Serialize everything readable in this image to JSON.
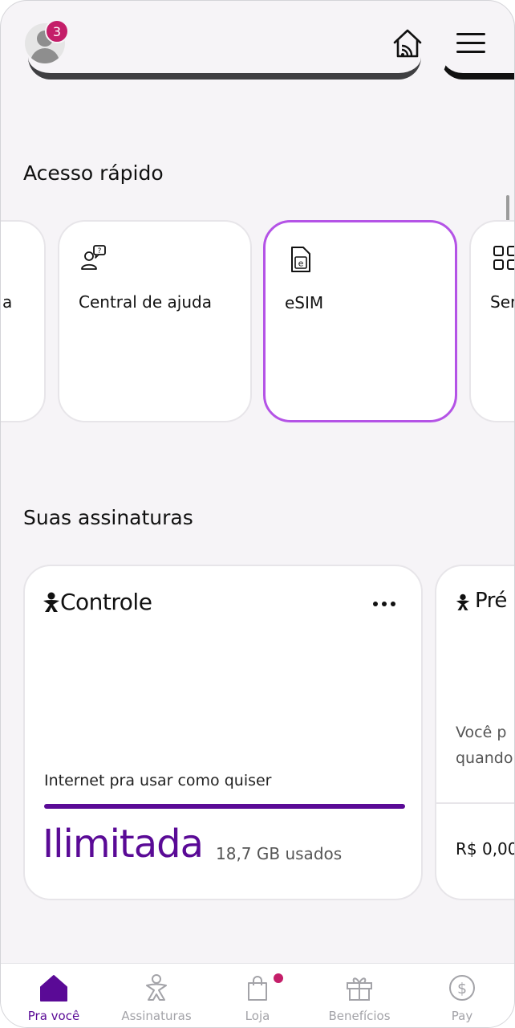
{
  "header": {
    "notification_count": "3",
    "avatar_icon": "user-avatar-icon",
    "home_icon": "smart-home-icon",
    "menu_icon": "hamburger-menu-icon"
  },
  "quick_access": {
    "title": "Acesso rápido",
    "items": [
      {
        "label": "a",
        "icon": ""
      },
      {
        "label": "Central de ajuda",
        "icon": "help-chat-icon"
      },
      {
        "label": "eSIM",
        "icon": "esim-icon"
      },
      {
        "label": "Ser",
        "icon": "grid-icon"
      }
    ]
  },
  "subscriptions": {
    "title": "Suas assinaturas",
    "cards": [
      {
        "brand": "Controle",
        "menu_icon": "more-dots-icon",
        "description": "Internet pra usar como quiser",
        "value": "Ilimitada",
        "usage": "18,7 GB usados",
        "progress": 1.0
      },
      {
        "brand": "Pré",
        "line1": "Você p",
        "line2": "quando",
        "price": "R$ 0,00"
      }
    ]
  },
  "bottom_nav": {
    "items": [
      {
        "label": "Pra você",
        "icon": "home-icon",
        "active": true
      },
      {
        "label": "Assinaturas",
        "icon": "vivo-person-icon",
        "active": false
      },
      {
        "label": "Loja",
        "icon": "shopping-bag-icon",
        "active": false
      },
      {
        "label": "Benefícios",
        "icon": "gift-icon",
        "active": false
      },
      {
        "label": "Pay",
        "icon": "dollar-circle-icon",
        "active": false
      }
    ]
  },
  "colors": {
    "accent": "#5a0a96",
    "selected_border": "#b453e6",
    "badge": "#c41e69",
    "background": "#f6f4f7"
  }
}
